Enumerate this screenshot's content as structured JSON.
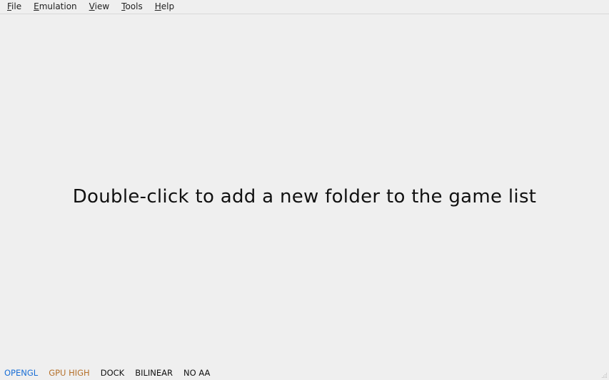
{
  "menubar": {
    "items": [
      {
        "mnemonic": "F",
        "rest": "ile"
      },
      {
        "mnemonic": "E",
        "rest": "mulation"
      },
      {
        "mnemonic": "V",
        "rest": "iew"
      },
      {
        "mnemonic": "T",
        "rest": "ools"
      },
      {
        "mnemonic": "H",
        "rest": "elp"
      }
    ]
  },
  "game_list": {
    "empty_hint": "Double-click to add a new folder to the game list"
  },
  "statusbar": {
    "items": [
      {
        "label": "OPENGL",
        "color": "#1a6fd6"
      },
      {
        "label": "GPU HIGH",
        "color": "#b5702a"
      },
      {
        "label": "DOCK",
        "color": "#111111"
      },
      {
        "label": "BILINEAR",
        "color": "#111111"
      },
      {
        "label": "NO AA",
        "color": "#111111"
      }
    ]
  }
}
